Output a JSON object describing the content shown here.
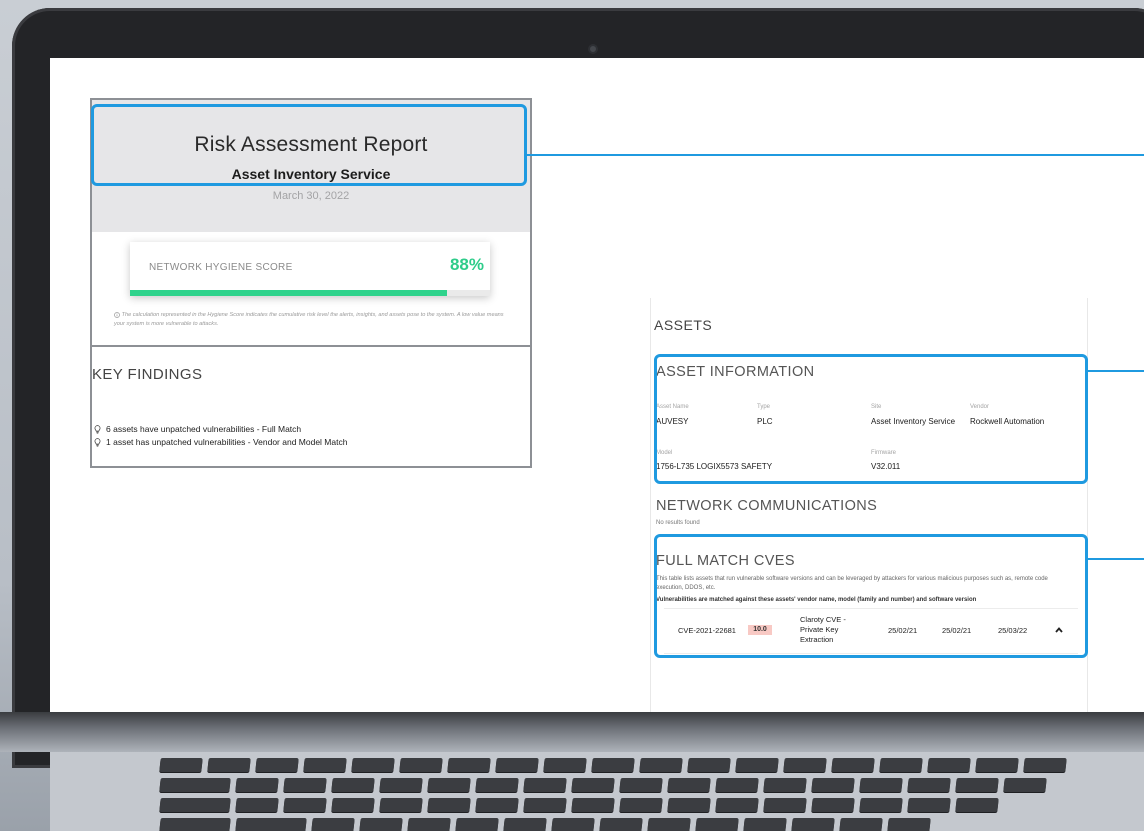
{
  "report": {
    "title": "Risk Assessment Report",
    "subtitle": "Asset Inventory Service",
    "date": "March 30, 2022",
    "hygiene": {
      "label": "NETWORK HYGIENE SCORE",
      "value_text": "88%",
      "value": 88,
      "note": "The calculation represented in the Hygiene Score indicates the cumulative risk level the alerts, insights, and assets pose to the system. A low value means your system is more vulnerable to attacks."
    },
    "findings": {
      "heading": "KEY FINDINGS",
      "items": [
        "6 assets have unpatched vulnerabilities - Full Match",
        "1 asset has unpatched vulnerabilities - Vendor and Model Match"
      ]
    }
  },
  "assets": {
    "heading": "ASSETS",
    "asset_information": {
      "heading": "ASSET INFORMATION",
      "labels": {
        "asset_name": "Asset Name",
        "type": "Type",
        "site": "Site",
        "vendor": "Vendor",
        "model": "Model",
        "firmware": "Firmware"
      },
      "values": {
        "asset_name": "AUVESY",
        "type": "PLC",
        "site": "Asset Inventory Service",
        "vendor": "Rockwell Automation",
        "model": "1756-L735 LOGIX5573 SAFETY",
        "firmware": "V32.011"
      }
    },
    "network_communications": {
      "heading": "NETWORK COMMUNICATIONS",
      "empty_text": "No results found"
    },
    "full_match_cves": {
      "heading": "FULL MATCH CVES",
      "description": "This table lists assets that run vulnerable software versions and can be leveraged by attackers for various malicious purposes such as, remote code execution, DDOS, etc.",
      "description_bold": "Vulnerabilities are matched against these assets' vendor name, model (family and number) and software version",
      "rows": [
        {
          "cve_id": "CVE-2021-22681",
          "score": "10.0",
          "name": "Claroty CVE - Private Key Extraction",
          "date1": "25/02/21",
          "date2": "25/02/21",
          "date3": "25/03/22"
        }
      ]
    }
  },
  "colors": {
    "accent": "#1f9ae0",
    "score_green": "#2fd38c",
    "cvss_badge": "#f8c9c4"
  },
  "icons": [
    "lightbulb-icon",
    "info-icon",
    "chevron-up-icon"
  ]
}
